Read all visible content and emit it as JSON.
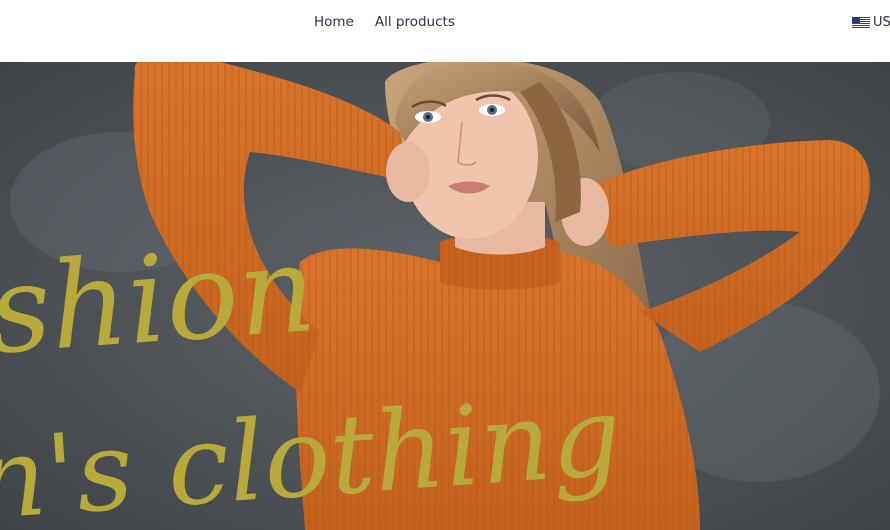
{
  "nav": {
    "items": [
      {
        "label": "Home"
      },
      {
        "label": "All products"
      }
    ]
  },
  "currency": {
    "label": "USD",
    "flag_icon": "us-flag-icon"
  },
  "hero": {
    "title_line1": "shion",
    "title_line2": "n's clothing",
    "text_color": "#b7a93a",
    "sweater_color": "#d2691e",
    "background_color": "#4e5358"
  }
}
